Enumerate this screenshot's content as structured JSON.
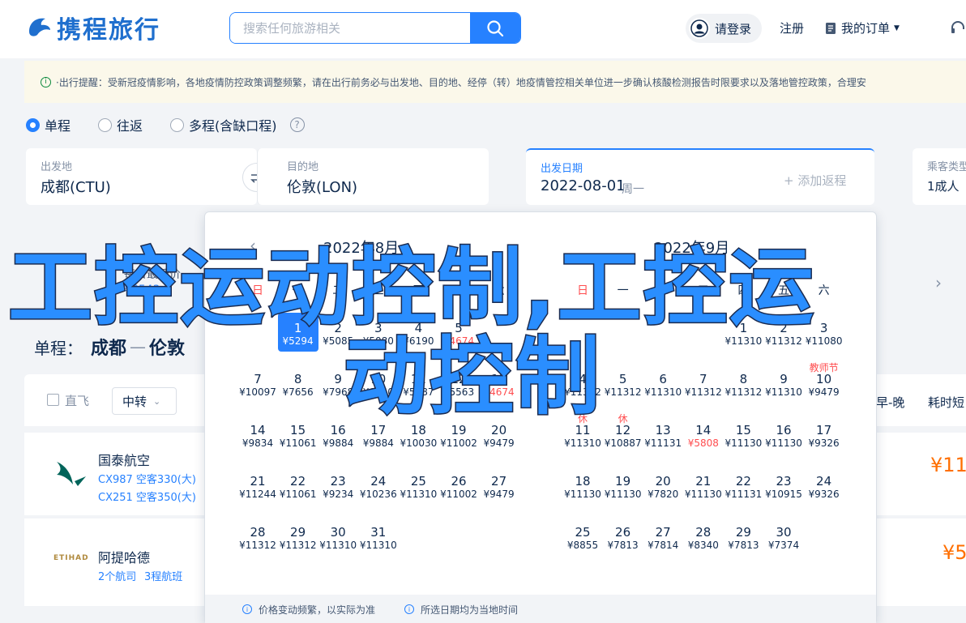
{
  "header": {
    "logo_text": "携程旅行",
    "search_placeholder": "搜索任何旅游相关",
    "login": "请登录",
    "register": "注册",
    "orders": "我的订单"
  },
  "notice": "·出行提醒：受新冠疫情影响，各地疫情防控政策调整频繁，请在出行前务必与出发地、目的地、经停（转）地疫情管控相关单位进一步确认核酸检测报告时限要求以及落地管控政策，合理安",
  "trip_types": {
    "one_way": "单程",
    "round": "往返",
    "multi": "多程(含缺口程)"
  },
  "fields": {
    "from_label": "出发地",
    "from_value": "成都(CTU)",
    "to_label": "目的地",
    "to_value": "伦敦(LON)",
    "date_label": "出发日期",
    "date_value": "2022-08-01",
    "weekday": "周一",
    "add_return": "+ 添加返程",
    "pax_label": "乘客类型",
    "pax_value": "1成人"
  },
  "route": {
    "prefix": "单程：",
    "from": "成都",
    "to": "伦敦"
  },
  "filters": {
    "direct": "直飞",
    "transfer": "中转",
    "early_late": "早-晚",
    "duration": "耗时短"
  },
  "results": [
    {
      "airline": "国泰航空",
      "line1": "CX987 空客330(大)",
      "line2": "CX251 空客350(大)",
      "price": "¥11"
    },
    {
      "airline": "阿提哈德",
      "line1": "2个航司",
      "line2": "3程航班",
      "price": "¥5"
    }
  ],
  "cal_left": {
    "title": "2022年8月",
    "weekdays": [
      "日",
      "一",
      "二",
      "三",
      "四",
      "五",
      "六"
    ],
    "top_label": "每日最低价",
    "top_price": "¥6543",
    "weeks": [
      [
        null,
        {
          "d": "1",
          "p": "¥5294",
          "sel": true
        },
        {
          "d": "2",
          "p": "¥5085"
        },
        {
          "d": "3",
          "p": "¥5080"
        },
        {
          "d": "4",
          "p": "¥6190"
        },
        {
          "d": "5",
          "p": "¥4674",
          "low": true
        },
        null
      ],
      [
        {
          "d": "7",
          "p": "¥10097"
        },
        {
          "d": "8",
          "p": "¥7656"
        },
        {
          "d": "9",
          "p": "¥7968"
        },
        {
          "d": "10",
          "p": "¥6140"
        },
        {
          "d": "11",
          "p": "¥5887"
        },
        {
          "d": "12",
          "p": "¥5563"
        },
        {
          "d": "13",
          "p": "¥4674",
          "low": true
        }
      ],
      [
        {
          "d": "14",
          "p": "¥9834"
        },
        {
          "d": "15",
          "p": "¥11061"
        },
        {
          "d": "16",
          "p": "¥9884"
        },
        {
          "d": "17",
          "p": "¥9884"
        },
        {
          "d": "18",
          "p": "¥10030"
        },
        {
          "d": "19",
          "p": "¥11002"
        },
        {
          "d": "20",
          "p": "¥9479"
        }
      ],
      [
        {
          "d": "21",
          "p": "¥11244"
        },
        {
          "d": "22",
          "p": "¥11061"
        },
        {
          "d": "23",
          "p": "¥9234"
        },
        {
          "d": "24",
          "p": "¥10236"
        },
        {
          "d": "25",
          "p": "¥11310"
        },
        {
          "d": "26",
          "p": "¥11002"
        },
        {
          "d": "27",
          "p": "¥9479"
        }
      ],
      [
        {
          "d": "28",
          "p": "¥11312"
        },
        {
          "d": "29",
          "p": "¥11312"
        },
        {
          "d": "30",
          "p": "¥11310"
        },
        {
          "d": "31",
          "p": "¥11310"
        },
        null,
        null,
        null
      ]
    ]
  },
  "cal_right": {
    "title": "2022年9月",
    "weekdays": [
      "日",
      "一",
      "二",
      "三",
      "四",
      "五",
      "六"
    ],
    "weeks": [
      [
        null,
        null,
        null,
        null,
        {
          "d": "1",
          "p": "¥11310"
        },
        {
          "d": "2",
          "p": "¥11312"
        },
        {
          "d": "3",
          "p": "¥11080"
        }
      ],
      [
        {
          "d": "4",
          "p": "¥11312"
        },
        {
          "d": "5",
          "p": "¥11312"
        },
        {
          "d": "6",
          "p": "¥11310"
        },
        {
          "d": "7",
          "p": "¥11312"
        },
        {
          "d": "8",
          "p": "¥11312"
        },
        {
          "d": "9",
          "p": "¥11310"
        },
        {
          "d": "10",
          "p": "¥9479",
          "tag": "教师节"
        }
      ],
      [
        {
          "d": "11",
          "p": "¥11310",
          "tag": "休"
        },
        {
          "d": "12",
          "p": "¥10887",
          "tag": "休"
        },
        {
          "d": "13",
          "p": "¥11131"
        },
        {
          "d": "14",
          "p": "¥5808",
          "low": true
        },
        {
          "d": "15",
          "p": "¥11130"
        },
        {
          "d": "16",
          "p": "¥11130"
        },
        {
          "d": "17",
          "p": "¥9326"
        }
      ],
      [
        {
          "d": "18",
          "p": "¥11130"
        },
        {
          "d": "19",
          "p": "¥11130"
        },
        {
          "d": "20",
          "p": "¥7820"
        },
        {
          "d": "21",
          "p": "¥11130"
        },
        {
          "d": "22",
          "p": "¥11131"
        },
        {
          "d": "23",
          "p": "¥10915"
        },
        {
          "d": "24",
          "p": "¥9326"
        }
      ],
      [
        {
          "d": "25",
          "p": "¥8855"
        },
        {
          "d": "26",
          "p": "¥7813"
        },
        {
          "d": "27",
          "p": "¥7814"
        },
        {
          "d": "28",
          "p": "¥8340"
        },
        {
          "d": "29",
          "p": "¥7813"
        },
        {
          "d": "30",
          "p": "¥7374"
        },
        null
      ]
    ]
  },
  "cal_footer": {
    "note1": "价格变动频繁，以实际为准",
    "note2": "所选日期均为当地时间"
  },
  "watermark": {
    "line1": "工控运动控制,工控运",
    "line2": "动控制"
  }
}
